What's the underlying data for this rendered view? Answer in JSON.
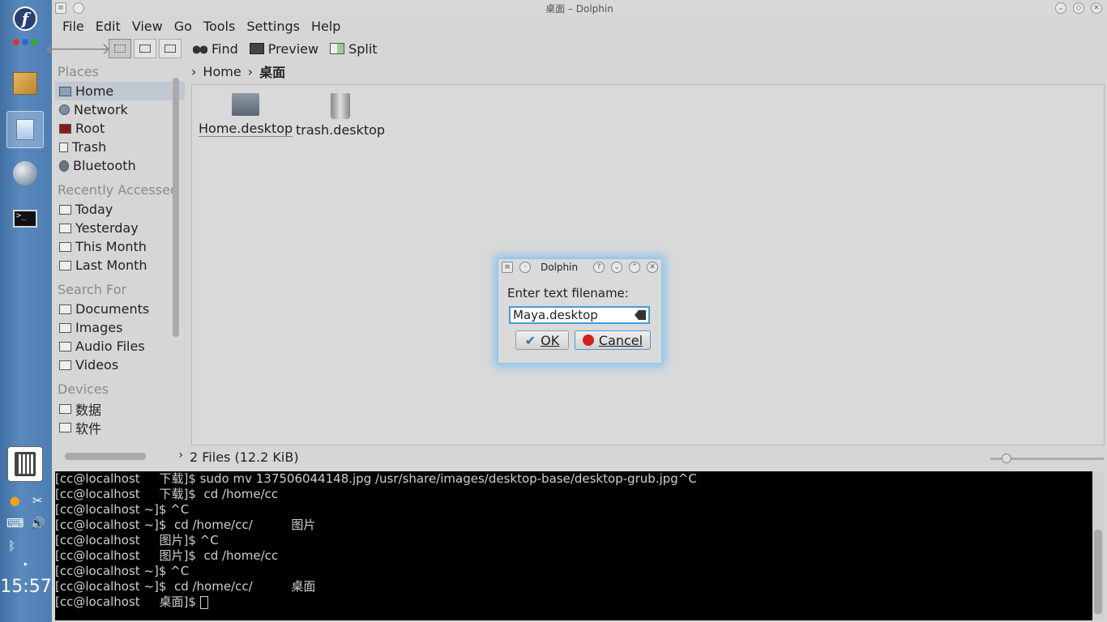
{
  "window": {
    "title": "桌面 – Dolphin"
  },
  "menu": [
    "File",
    "Edit",
    "View",
    "Go",
    "Tools",
    "Settings",
    "Help"
  ],
  "toolbar": {
    "find": "Find",
    "preview": "Preview",
    "split": "Split"
  },
  "breadcrumb": {
    "home": "Home",
    "current": "桌面"
  },
  "places": {
    "places_header": "Places",
    "places_items": [
      "Home",
      "Network",
      "Root",
      "Trash",
      "Bluetooth"
    ],
    "recent_header": "Recently Accessed",
    "recent_items": [
      "Today",
      "Yesterday",
      "This Month",
      "Last Month"
    ],
    "search_header": "Search For",
    "search_items": [
      "Documents",
      "Images",
      "Audio Files",
      "Videos"
    ],
    "devices_header": "Devices",
    "devices_items": [
      "数据",
      "软件"
    ]
  },
  "files": [
    {
      "name": "Home.desktop",
      "icon": "folder-home-icon"
    },
    {
      "name": "trash.desktop",
      "icon": "trash-icon"
    }
  ],
  "status": "2 Files (12.2 KiB)",
  "terminal": {
    "lines": [
      "[cc@localhost     下载]$ sudo mv 137506044148.jpg /usr/share/images/desktop-base/desktop-grub.jpg^C",
      "[cc@localhost     下载]$  cd /home/cc",
      "[cc@localhost ~]$ ^C",
      "[cc@localhost ~]$  cd /home/cc/          图片",
      "[cc@localhost     图片]$ ^C",
      "[cc@localhost     图片]$  cd /home/cc",
      "[cc@localhost ~]$ ^C",
      "[cc@localhost ~]$  cd /home/cc/          桌面",
      "[cc@localhost     桌面]$ "
    ]
  },
  "dialog": {
    "title": "Dolphin",
    "label": "Enter text filename:",
    "value": "Maya.desktop",
    "ok": "OK",
    "cancel": "Cancel"
  },
  "clock": "15:57",
  "colors": {
    "panel": "#4d7db2",
    "accent": "#4a9bd6",
    "terminal_bg": "#000000"
  }
}
